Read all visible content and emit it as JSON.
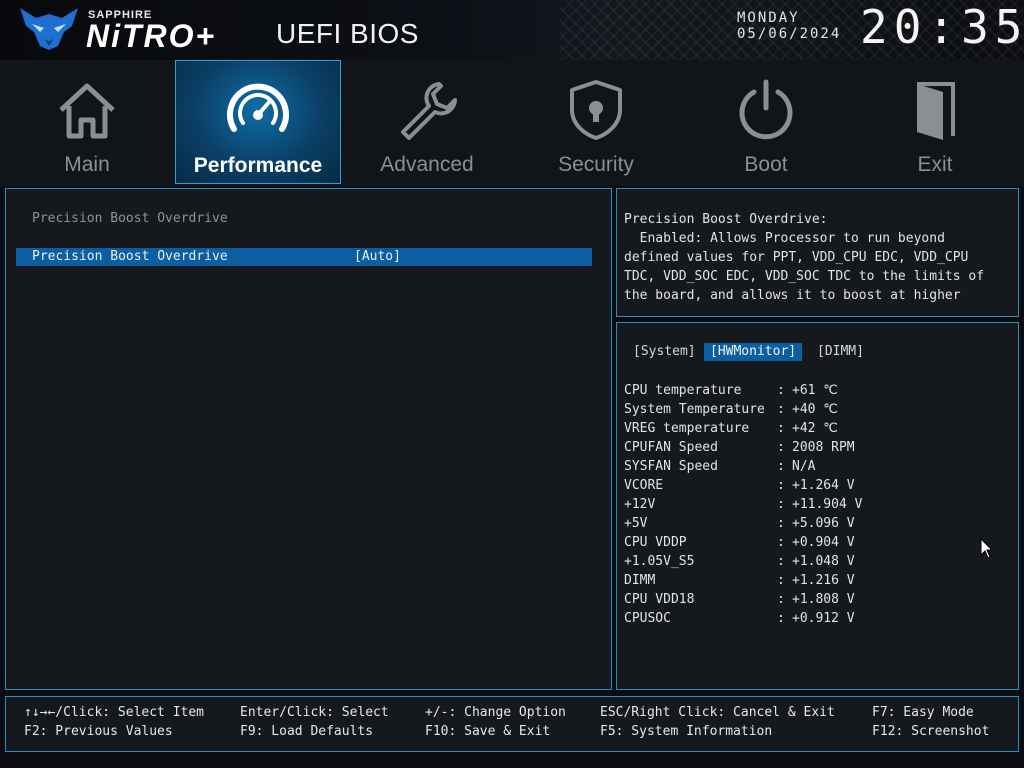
{
  "header": {
    "brand_small": "SAPPHIRE",
    "brand_big": "NiTRO",
    "brand_plus": "+",
    "title": "UEFI BIOS",
    "day": "MONDAY",
    "date": "05/06/2024",
    "time": "20:35"
  },
  "tabs": [
    {
      "label": "Main",
      "icon": "home-icon"
    },
    {
      "label": "Performance",
      "icon": "speedometer-icon",
      "active": true
    },
    {
      "label": "Advanced",
      "icon": "wrench-icon"
    },
    {
      "label": "Security",
      "icon": "shield-lock-icon"
    },
    {
      "label": "Boot",
      "icon": "power-icon"
    },
    {
      "label": "Exit",
      "icon": "door-exit-icon"
    }
  ],
  "main": {
    "heading": "Precision Boost Overdrive",
    "selected_item": {
      "label": "Precision Boost Overdrive",
      "value": "[Auto]"
    }
  },
  "help": {
    "text": "Precision Boost Overdrive:\n  Enabled: Allows Processor to run beyond\ndefined values for PPT, VDD_CPU EDC, VDD_CPU\nTDC, VDD_SOC EDC, VDD_SOC TDC to the limits of\nthe board, and allows it to boost at higher"
  },
  "hw_monitor": {
    "tabs": [
      "[System]",
      "[HWMonitor]",
      "[DIMM]"
    ],
    "active_tab": "[HWMonitor]",
    "rows": [
      {
        "name": "CPU temperature",
        "value": "+61 ℃"
      },
      {
        "name": "System Temperature",
        "value": "+40 ℃"
      },
      {
        "name": "VREG temperature",
        "value": "+42 ℃"
      },
      {
        "name": "CPUFAN Speed",
        "value": "2008 RPM"
      },
      {
        "name": "SYSFAN Speed",
        "value": "N/A"
      },
      {
        "name": "VCORE",
        "value": "+1.264 V"
      },
      {
        "name": "+12V",
        "value": "+11.904 V"
      },
      {
        "name": "+5V",
        "value": "+5.096 V"
      },
      {
        "name": "CPU VDDP",
        "value": "+0.904 V"
      },
      {
        "name": "+1.05V_S5",
        "value": "+1.048 V"
      },
      {
        "name": "DIMM",
        "value": "+1.216 V"
      },
      {
        "name": "CPU VDD18",
        "value": "+1.808 V"
      },
      {
        "name": "CPUSOC",
        "value": "+0.912 V"
      }
    ]
  },
  "footer": {
    "select_item": "↑↓→←/Click: Select Item",
    "enter": "Enter/Click: Select",
    "change": "+/-: Change Option",
    "esc": "ESC/Right Click: Cancel & Exit",
    "f7": "F7: Easy Mode",
    "f2": "F2: Previous Values",
    "f9": "F9: Load Defaults",
    "f10": "F10: Save & Exit",
    "f5": "F5: System Information",
    "f12": "F12: Screenshot"
  },
  "colors": {
    "accent_blue": "#0b5fa0",
    "border_blue": "#2d8bc0",
    "active_tab_bg": "#0a3f66",
    "panel_bg": "#15181c"
  }
}
